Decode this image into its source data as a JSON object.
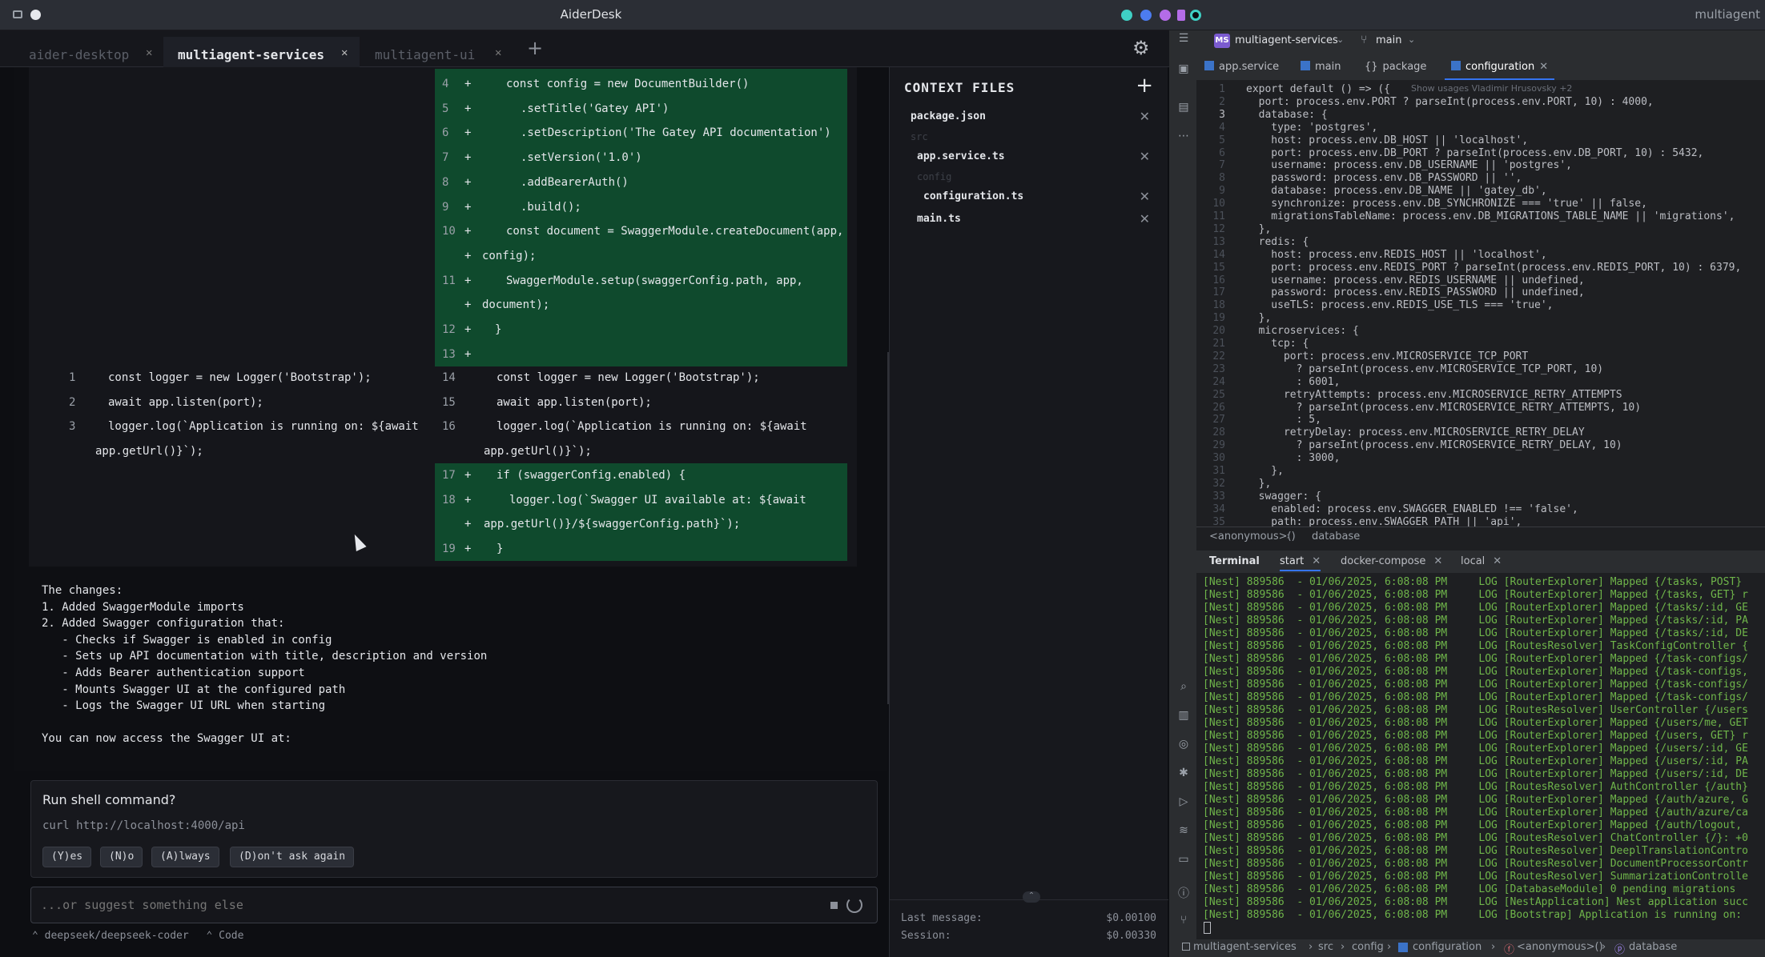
{
  "window": {
    "title": "AiderDesk",
    "right_title": "multiagent"
  },
  "tabs": [
    {
      "label": "aider-desktop",
      "active": false
    },
    {
      "label": "multiagent-services",
      "active": true
    },
    {
      "label": "multiagent-ui",
      "active": false
    }
  ],
  "diff": {
    "right_added_top": [
      {
        "n": "4",
        "code": "const config = new DocumentBuilder()"
      },
      {
        "n": "5",
        "code": ".setTitle('Gatey API')"
      },
      {
        "n": "6",
        "code": ".setDescription('The Gatey API documentation')"
      },
      {
        "n": "7",
        "code": ".setVersion('1.0')"
      },
      {
        "n": "8",
        "code": ".addBearerAuth()"
      },
      {
        "n": "9",
        "code": ".build();"
      },
      {
        "n": "10",
        "code": "const document = SwaggerModule.createDocument(app,"
      },
      {
        "n": "",
        "code": "config);"
      },
      {
        "n": "11",
        "code": "SwaggerModule.setup(swaggerConfig.path, app,"
      },
      {
        "n": "",
        "code": "document);"
      },
      {
        "n": "12",
        "code": "}"
      },
      {
        "n": "13",
        "code": ""
      }
    ],
    "left_context": [
      {
        "n": "1",
        "code": "const logger = new Logger('Bootstrap');"
      },
      {
        "n": "2",
        "code": "await app.listen(port);"
      },
      {
        "n": "3",
        "code": "logger.log(`Application is running on: ${await"
      },
      {
        "n": "",
        "code": "app.getUrl()}`);"
      }
    ],
    "right_context": [
      {
        "n": "14",
        "code": "const logger = new Logger('Bootstrap');"
      },
      {
        "n": "15",
        "code": "await app.listen(port);"
      },
      {
        "n": "16",
        "code": "logger.log(`Application is running on: ${await"
      },
      {
        "n": "",
        "code": "app.getUrl()}`);"
      }
    ],
    "right_added_bottom": [
      {
        "n": "17",
        "code": "if (swaggerConfig.enabled) {"
      },
      {
        "n": "18",
        "code": "logger.log(`Swagger UI available at: ${await"
      },
      {
        "n": "",
        "code": "app.getUrl()}/${swaggerConfig.path}`);"
      },
      {
        "n": "19",
        "code": "}"
      }
    ]
  },
  "changes_text": "The changes:\n1. Added SwaggerModule imports\n2. Added Swagger configuration that:\n   - Checks if Swagger is enabled in config\n   - Sets up API documentation with title, description and version\n   - Adds Bearer authentication support\n   - Mounts Swagger UI at the configured path\n   - Logs the Swagger UI URL when starting\n\nYou can now access the Swagger UI at:",
  "prompt": {
    "question": "Run shell command?",
    "command": "curl http://localhost:4000/api",
    "buttons": [
      "(Y)es",
      "(N)o",
      "(A)lways",
      "(D)on't ask again"
    ]
  },
  "input": {
    "placeholder": "...or suggest something else"
  },
  "status": {
    "model": "deepseek/deepseek-coder",
    "mode": "Code"
  },
  "context": {
    "header": "CONTEXT FILES",
    "files": [
      {
        "name": "package.json",
        "kind": "file"
      },
      {
        "name": "src",
        "kind": "dir"
      },
      {
        "name": "app.service.ts",
        "kind": "file"
      },
      {
        "name": "config",
        "kind": "dir"
      },
      {
        "name": "configuration.ts",
        "kind": "file"
      },
      {
        "name": "main.ts",
        "kind": "file"
      }
    ],
    "last_message_label": "Last message:",
    "last_message_value": "$0.00100",
    "session_label": "Session:",
    "session_value": "$0.00330"
  },
  "ide": {
    "project": "multiagent-services",
    "project_badge": "MS",
    "branch": "main",
    "file_tabs": [
      "app.service",
      "main",
      "package",
      "configuration"
    ],
    "hint": "Show usages   Vladimir Hrusovsky +2",
    "code_lines": [
      "export default () => ({",
      "  port: process.env.PORT ? parseInt(process.env.PORT, 10) : 4000,",
      "  database: {",
      "    type: 'postgres',",
      "    host: process.env.DB_HOST || 'localhost',",
      "    port: process.env.DB_PORT ? parseInt(process.env.DB_PORT, 10) : 5432,",
      "    username: process.env.DB_USERNAME || 'postgres',",
      "    password: process.env.DB_PASSWORD || '',",
      "    database: process.env.DB_NAME || 'gatey_db',",
      "    synchronize: process.env.DB_SYNCHRONIZE === 'true' || false,",
      "    migrationsTableName: process.env.DB_MIGRATIONS_TABLE_NAME || 'migrations',",
      "  },",
      "  redis: {",
      "    host: process.env.REDIS_HOST || 'localhost',",
      "    port: process.env.REDIS_PORT ? parseInt(process.env.REDIS_PORT, 10) : 6379,",
      "    username: process.env.REDIS_USERNAME || undefined,",
      "    password: process.env.REDIS_PASSWORD || undefined,",
      "    useTLS: process.env.REDIS_USE_TLS === 'true',",
      "  },",
      "  microservices: {",
      "    tcp: {",
      "      port: process.env.MICROSERVICE_TCP_PORT",
      "        ? parseInt(process.env.MICROSERVICE_TCP_PORT, 10)",
      "        : 6001,",
      "      retryAttempts: process.env.MICROSERVICE_RETRY_ATTEMPTS",
      "        ? parseInt(process.env.MICROSERVICE_RETRY_ATTEMPTS, 10)",
      "        : 5,",
      "      retryDelay: process.env.MICROSERVICE_RETRY_DELAY",
      "        ? parseInt(process.env.MICROSERVICE_RETRY_DELAY, 10)",
      "        : 3000,",
      "    },",
      "  },",
      "  swagger: {",
      "    enabled: process.env.SWAGGER_ENABLED !== 'false',",
      "    path: process.env.SWAGGER_PATH || 'api',"
    ],
    "code_breadcrumb": [
      "<anonymous>()",
      "database"
    ],
    "terminal_tabs": [
      "Terminal",
      "start",
      "docker-compose",
      "local"
    ],
    "terminal_lines": [
      "[Nest] 889586  - 01/06/2025, 6:08:08 PM     LOG [RouterExplorer] Mapped {/tasks, POST}",
      "[Nest] 889586  - 01/06/2025, 6:08:08 PM     LOG [RouterExplorer] Mapped {/tasks, GET} r",
      "[Nest] 889586  - 01/06/2025, 6:08:08 PM     LOG [RouterExplorer] Mapped {/tasks/:id, GE",
      "[Nest] 889586  - 01/06/2025, 6:08:08 PM     LOG [RouterExplorer] Mapped {/tasks/:id, PA",
      "[Nest] 889586  - 01/06/2025, 6:08:08 PM     LOG [RouterExplorer] Mapped {/tasks/:id, DE",
      "[Nest] 889586  - 01/06/2025, 6:08:08 PM     LOG [RoutesResolver] TaskConfigController {",
      "[Nest] 889586  - 01/06/2025, 6:08:08 PM     LOG [RouterExplorer] Mapped {/task-configs/",
      "[Nest] 889586  - 01/06/2025, 6:08:08 PM     LOG [RouterExplorer] Mapped {/task-configs,",
      "[Nest] 889586  - 01/06/2025, 6:08:08 PM     LOG [RouterExplorer] Mapped {/task-configs/",
      "[Nest] 889586  - 01/06/2025, 6:08:08 PM     LOG [RouterExplorer] Mapped {/task-configs/",
      "[Nest] 889586  - 01/06/2025, 6:08:08 PM     LOG [RoutesResolver] UserController {/users",
      "[Nest] 889586  - 01/06/2025, 6:08:08 PM     LOG [RouterExplorer] Mapped {/users/me, GET",
      "[Nest] 889586  - 01/06/2025, 6:08:08 PM     LOG [RouterExplorer] Mapped {/users, GET} r",
      "[Nest] 889586  - 01/06/2025, 6:08:08 PM     LOG [RouterExplorer] Mapped {/users/:id, GE",
      "[Nest] 889586  - 01/06/2025, 6:08:08 PM     LOG [RouterExplorer] Mapped {/users/:id, PA",
      "[Nest] 889586  - 01/06/2025, 6:08:08 PM     LOG [RouterExplorer] Mapped {/users/:id, DE",
      "[Nest] 889586  - 01/06/2025, 6:08:08 PM     LOG [RoutesResolver] AuthController {/auth}",
      "[Nest] 889586  - 01/06/2025, 6:08:08 PM     LOG [RouterExplorer] Mapped {/auth/azure, G",
      "[Nest] 889586  - 01/06/2025, 6:08:08 PM     LOG [RouterExplorer] Mapped {/auth/azure/ca",
      "[Nest] 889586  - 01/06/2025, 6:08:08 PM     LOG [RouterExplorer] Mapped {/auth/logout,",
      "[Nest] 889586  - 01/06/2025, 6:08:08 PM     LOG [RoutesResolver] ChatController {/}: +0",
      "[Nest] 889586  - 01/06/2025, 6:08:08 PM     LOG [RoutesResolver] DeeplTranslationContro",
      "[Nest] 889586  - 01/06/2025, 6:08:08 PM     LOG [RoutesResolver] DocumentProcessorContr",
      "[Nest] 889586  - 01/06/2025, 6:08:08 PM     LOG [RoutesResolver] SummarizationControlle",
      "[Nest] 889586  - 01/06/2025, 6:08:08 PM     LOG [DatabaseModule] 0 pending migrations",
      "[Nest] 889586  - 01/06/2025, 6:08:08 PM     LOG [NestApplication] Nest application succ",
      "[Nest] 889586  - 01/06/2025, 6:08:08 PM     LOG [Bootstrap] Application is running on:"
    ],
    "statusbar": [
      "multiagent-services",
      "src",
      "config",
      "configuration",
      "<anonymous>()",
      "database"
    ]
  }
}
